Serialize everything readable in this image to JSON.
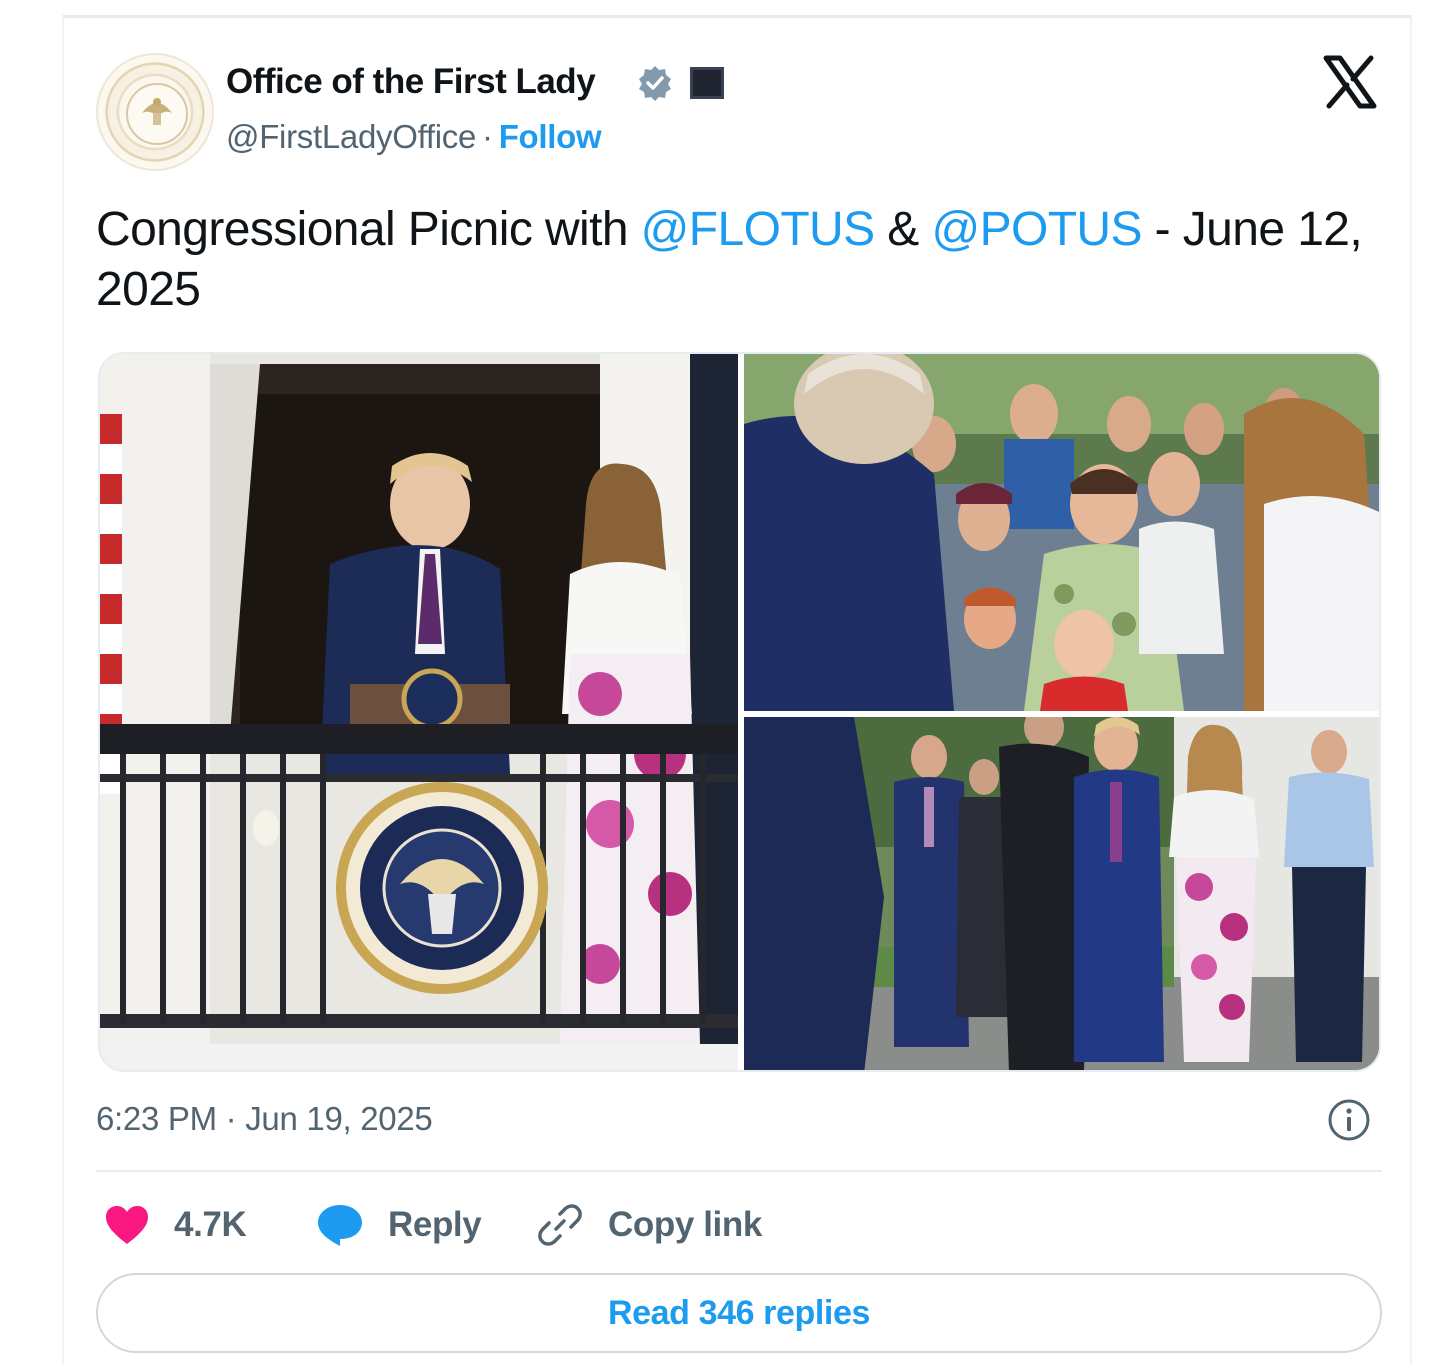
{
  "account": {
    "display_name": "Office of the First Lady",
    "handle": "@FirstLadyOffice",
    "separator": "·",
    "follow_label": "Follow",
    "avatar_icon": "presidential-seal",
    "verified_icon": "verified-badge-icon",
    "affiliation_icon": "flag-icon"
  },
  "tweet": {
    "text_before": "Congressional Picnic with ",
    "mention_1": "@FLOTUS",
    "text_middle": " & ",
    "mention_2": "@POTUS",
    "text_after": " - June 12, 2025",
    "media": [
      {
        "description_icon": "photo-balcony"
      },
      {
        "description_icon": "photo-crowd"
      },
      {
        "description_icon": "photo-lawn"
      }
    ]
  },
  "meta": {
    "timestamp": "6:23 PM · Jun 19, 2025"
  },
  "actions": {
    "like_count": "4.7K",
    "reply_label": "Reply",
    "copy_link_label": "Copy link",
    "read_replies_label": "Read 346 replies"
  },
  "colors": {
    "accent": "#1d9bf0",
    "like": "#f91880",
    "text_secondary": "#536471",
    "text_primary": "#0f1419",
    "border": "#cfd9de"
  }
}
